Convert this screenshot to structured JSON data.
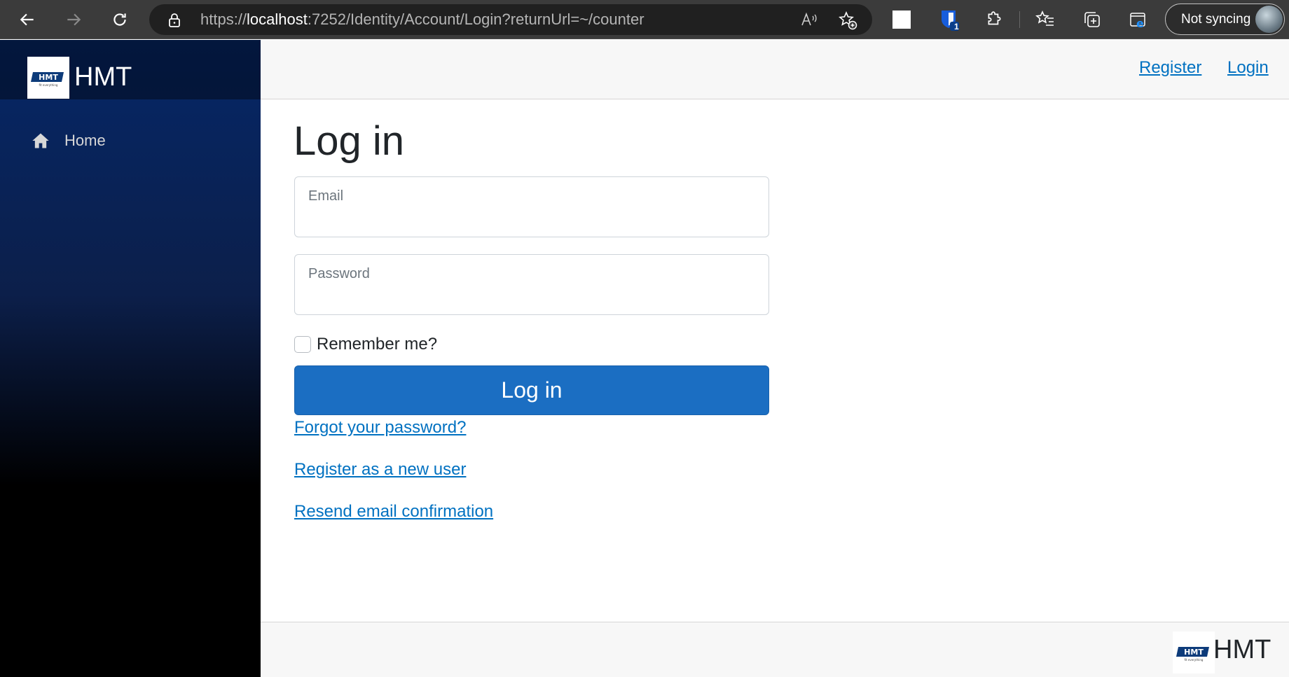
{
  "browser": {
    "url_prefix": "https://",
    "url_host": "localhost",
    "url_rest": ":7252/Identity/Account/Login?returnUrl=~/counter",
    "sync_label": "Not syncing",
    "extension_badge": "1",
    "icons": [
      "back-icon",
      "forward-icon",
      "refresh-icon",
      "lock-icon",
      "read-aloud-icon",
      "add-favorite-icon",
      "extension-square-icon",
      "bitwarden-icon",
      "extensions-icon",
      "favorites-icon",
      "collections-icon",
      "ie-mode-icon"
    ]
  },
  "sidebar": {
    "logo_text": "HMT",
    "logo_tagline": "fit everything",
    "brand": "HMT",
    "items": [
      {
        "label": "Home",
        "icon": "home-icon"
      }
    ]
  },
  "topbar": {
    "register": "Register",
    "login": "Login"
  },
  "main": {
    "title": "Log in",
    "email_placeholder": "Email",
    "password_placeholder": "Password",
    "remember_label": "Remember me?",
    "remember_checked": false,
    "submit_label": "Log in",
    "links": {
      "forgot": "Forgot your password?",
      "register": "Register as a new user",
      "resend": "Resend email confirmation"
    }
  },
  "footer": {
    "brand": "HMT"
  },
  "colors": {
    "primary": "#1b6ec2",
    "link": "#0071c1",
    "sidebar_top": "#052767",
    "sidebar_bottom": "#000000",
    "chrome": "#3b3b3b"
  }
}
